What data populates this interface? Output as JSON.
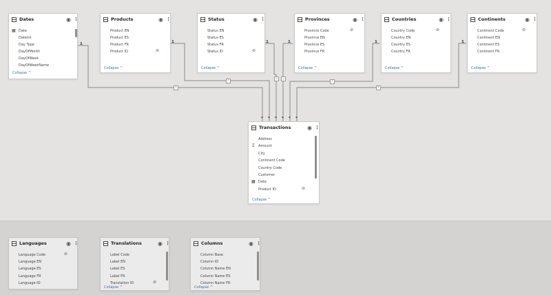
{
  "tables": {
    "dates": {
      "name": "Dates",
      "fields": [
        "Date",
        "Dateint",
        "Day Type",
        "DayOfMonth",
        "DayOfWeek",
        "DayOfWeekName"
      ],
      "collapse": "Collapse ^"
    },
    "products": {
      "name": "Products",
      "fields": [
        "Product EN",
        "Product ES",
        "Product FR",
        "Product ID"
      ],
      "collapse": "Collapse ^"
    },
    "status": {
      "name": "Status",
      "fields": [
        "Status EN",
        "Status ES",
        "Status FR",
        "Status ID"
      ],
      "collapse": "Collapse ^"
    },
    "provinces": {
      "name": "Provinces",
      "fields": [
        "Province Code",
        "Province EN",
        "Province ES",
        "Province FR"
      ],
      "collapse": "Collapse ^"
    },
    "countries": {
      "name": "Countries",
      "fields": [
        "Country Code",
        "Country EN",
        "Country ES",
        "Country FR"
      ],
      "collapse": "Collapse ^"
    },
    "continents": {
      "name": "Continents",
      "fields": [
        "Continent Code",
        "Continent EN",
        "Continent ES",
        "Continent FR"
      ],
      "collapse": "Collapse ^"
    },
    "transactions": {
      "name": "Transactions",
      "fields": [
        "Address",
        "Amount",
        "City",
        "Continent Code",
        "Country Code",
        "Customer",
        "Date",
        "Product ID"
      ],
      "collapse": "Collapse ^"
    },
    "languages": {
      "name": "Languages",
      "fields": [
        "Language Code",
        "Language EN",
        "Language ES",
        "Language FR",
        "Language ID"
      ],
      "collapse": ""
    },
    "translations": {
      "name": "Translations",
      "fields": [
        "Label Code",
        "Label EN",
        "Label ES",
        "Label FR",
        "Translation ID"
      ],
      "collapse": "Collapse ^"
    },
    "columns": {
      "name": "Columns",
      "fields": [
        "Column Base",
        "Column ID",
        "Column Name EN",
        "Column Name ES",
        "Column Name FR"
      ],
      "collapse": "Collapse ^"
    }
  },
  "relationships": {
    "one_label": "1",
    "many_label": "*"
  },
  "icons": {
    "eye": "eye-icon",
    "more": "more-options-icon",
    "hidden": "eye-slash-icon",
    "sigma": "sigma-icon",
    "calendar": "calendar-icon"
  },
  "colors": {
    "accent": "#3a6fb5",
    "line": "#8a8a8a"
  }
}
